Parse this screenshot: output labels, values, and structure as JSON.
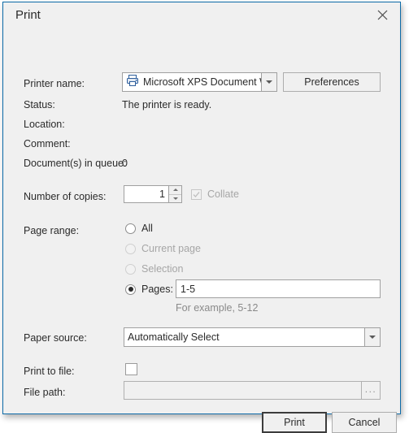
{
  "window": {
    "title": "Print",
    "close_icon": "close-icon",
    "accent_border": "#0d6ba8",
    "background": "#f0f0f0"
  },
  "printer": {
    "name_label": "Printer name:",
    "selected": "Microsoft XPS Document Wr...",
    "icon": "printer-icon",
    "dropdown_icon": "chevron-down-icon",
    "preferences_label": "Preferences",
    "status_label": "Status:",
    "status_value": "The printer is ready.",
    "location_label": "Location:",
    "location_value": "",
    "comment_label": "Comment:",
    "comment_value": "",
    "queue_label": "Document(s) in queue:",
    "queue_value": "0"
  },
  "copies": {
    "label": "Number of copies:",
    "value": "1",
    "spin_up_icon": "triangle-up-icon",
    "spin_down_icon": "triangle-down-icon",
    "collate_label": "Collate",
    "collate_checked": true,
    "collate_enabled": false
  },
  "page_range": {
    "label": "Page range:",
    "options": [
      {
        "label": "All",
        "selected": false,
        "enabled": true
      },
      {
        "label": "Current page",
        "selected": false,
        "enabled": false
      },
      {
        "label": "Selection",
        "selected": false,
        "enabled": false
      },
      {
        "label": "Pages:",
        "selected": true,
        "enabled": true
      }
    ],
    "pages_value": "1-5",
    "pages_hint": "For example, 5-12"
  },
  "paper_source": {
    "label": "Paper source:",
    "selected": "Automatically Select",
    "dropdown_icon": "chevron-down-icon"
  },
  "print_to_file": {
    "label": "Print to file:",
    "checked": false,
    "path_label": "File path:",
    "path_value": "",
    "browse_label": "...",
    "enabled": false
  },
  "footer": {
    "print_label": "Print",
    "cancel_label": "Cancel"
  }
}
